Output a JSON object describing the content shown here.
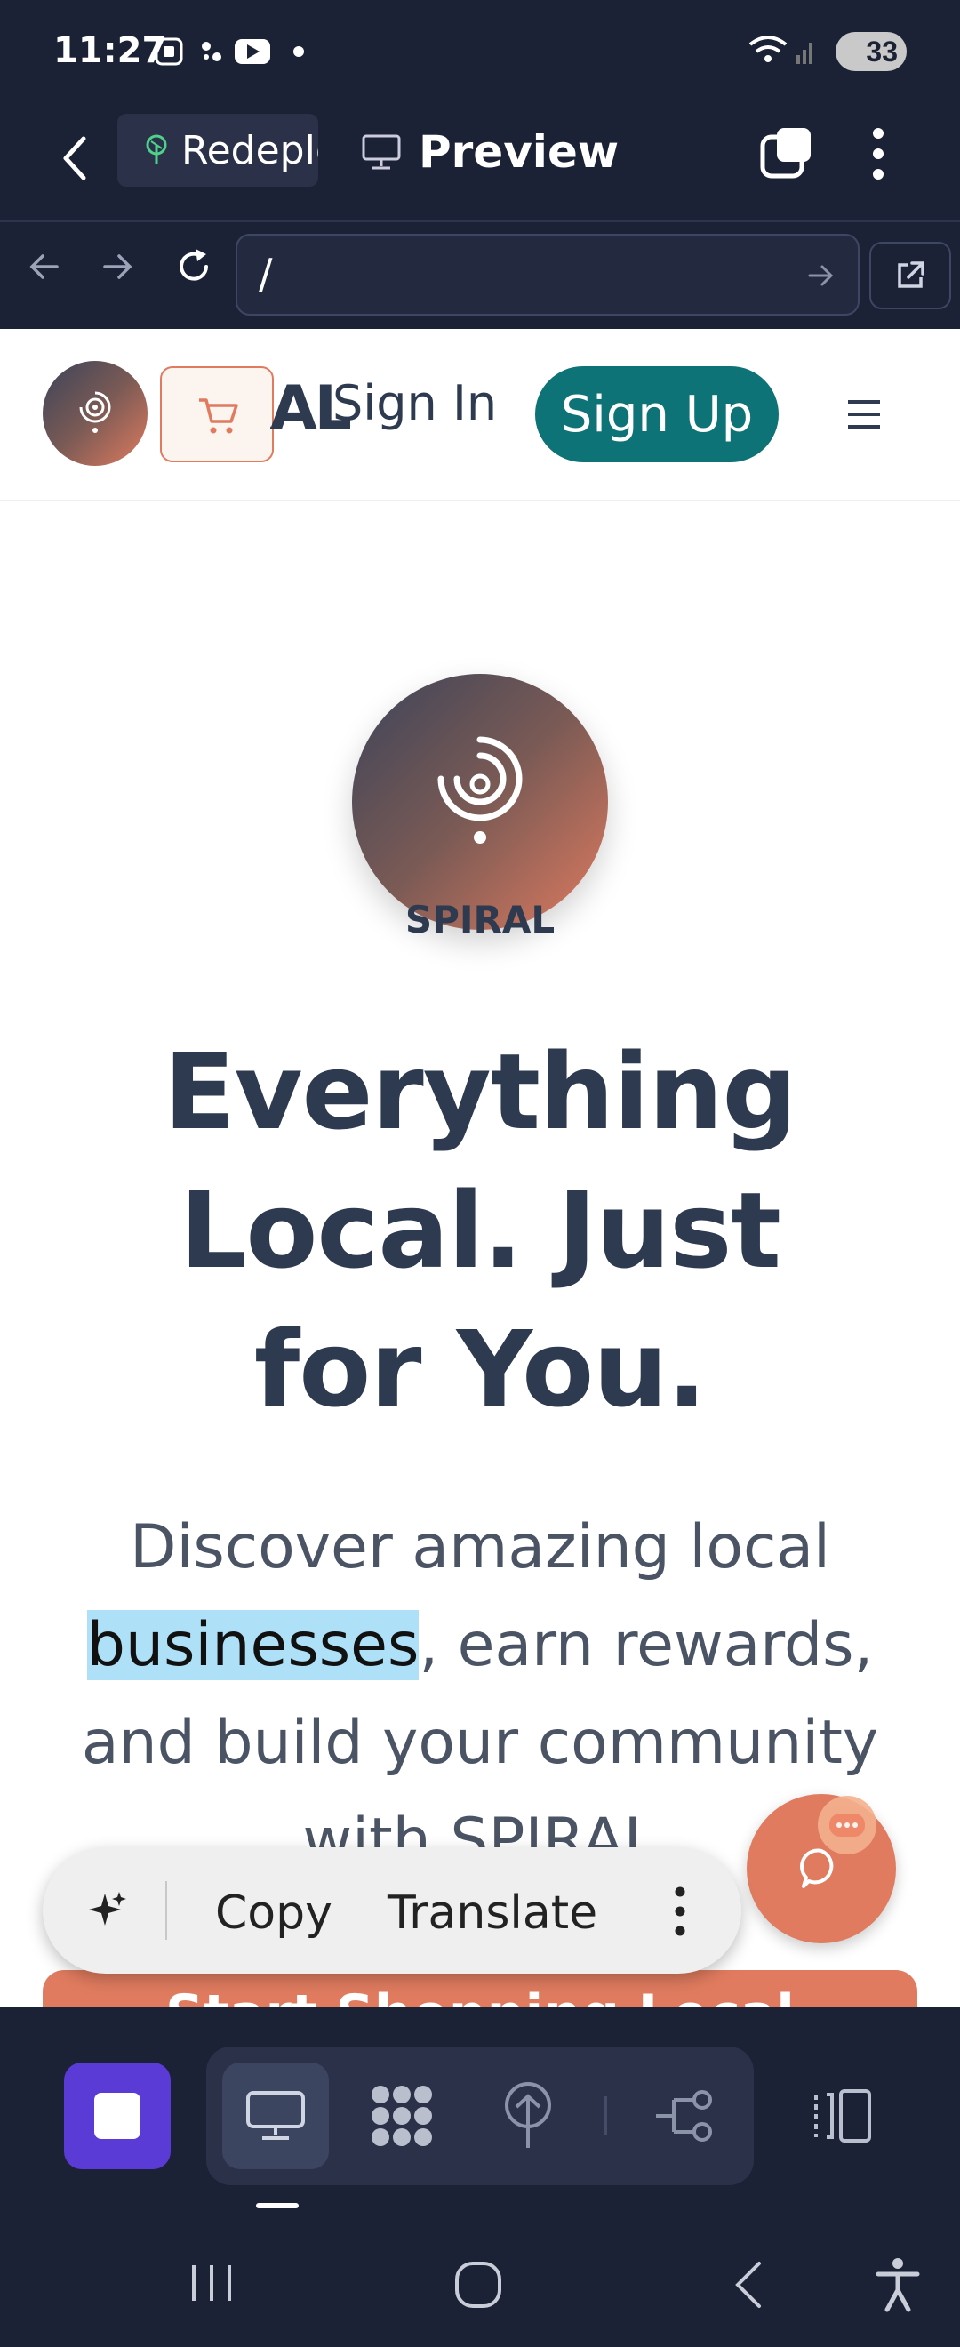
{
  "status_bar": {
    "time": "11:27",
    "battery": "33"
  },
  "app_bar": {
    "tab_label": "Redeploy",
    "preview_label": "Preview"
  },
  "url_bar": {
    "url": "/"
  },
  "site_header": {
    "brand_text": "SPIRAL",
    "sign_in": "Sign In",
    "sign_up": "Sign Up"
  },
  "hero": {
    "logo_label": "SPIRAL",
    "title_line1": "Everything",
    "title_line2": "Local. Just",
    "title_line3": "for You.",
    "subtitle_part1": "Discover amazing local",
    "subtitle_highlight": "businesses",
    "subtitle_part2": ", earn rewards,",
    "subtitle_line3": "and build your community",
    "subtitle_line4": "with SPIRAL",
    "cta_label": "Start Shopping Local"
  },
  "selection_menu": {
    "copy": "Copy",
    "translate": "Translate"
  },
  "colors": {
    "dark_bg": "#1c2236",
    "teal": "#0e7376",
    "accent_orange": "#e07b5f",
    "heading": "#2d3a4f",
    "purple": "#5b3bd6"
  },
  "icons": [
    "back-arrow-icon",
    "tree-icon",
    "monitor-icon",
    "copy-window-icon",
    "kebab-icon",
    "forward-arrow-icon",
    "reload-icon",
    "external-link-icon",
    "spiral-logo-icon",
    "cart-icon",
    "hamburger-icon",
    "chat-icon",
    "sparkle-icon"
  ]
}
